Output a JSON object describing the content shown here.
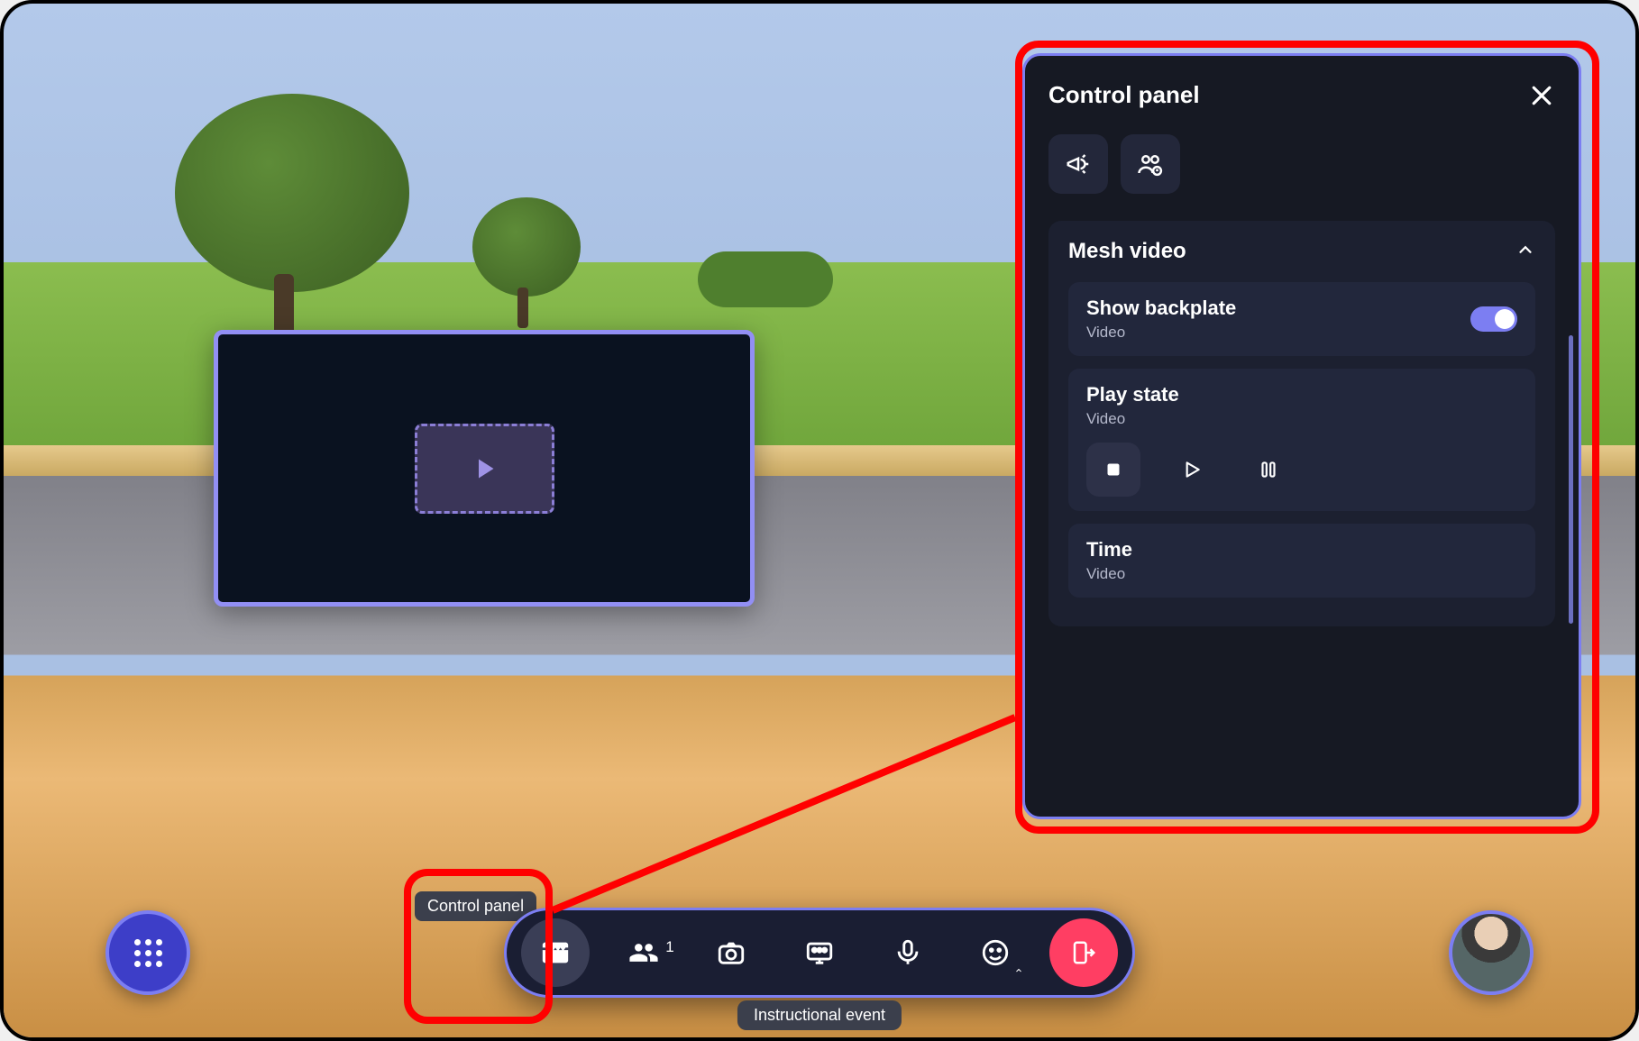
{
  "tooltip": {
    "control_panel": "Control panel"
  },
  "footer": {
    "event_label": "Instructional event"
  },
  "toolbar": {
    "participants_count": "1"
  },
  "panel": {
    "title": "Control panel",
    "section": {
      "mesh_video": {
        "heading": "Mesh video",
        "backplate": {
          "title": "Show backplate",
          "sub": "Video",
          "on": true
        },
        "playstate": {
          "title": "Play state",
          "sub": "Video"
        },
        "time": {
          "title": "Time",
          "sub": "Video"
        }
      }
    }
  }
}
